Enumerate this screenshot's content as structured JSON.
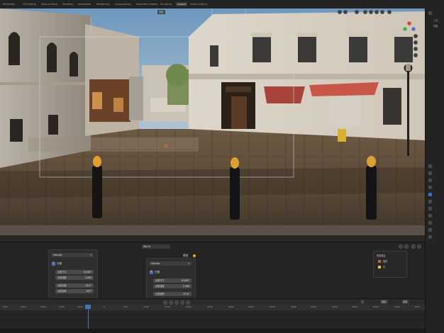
{
  "topbar": {
    "tabs": [
      {
        "label": "Modeling",
        "active": false
      },
      {
        "label": "UV Editing",
        "active": false
      },
      {
        "label": "Texture Paint",
        "active": false
      },
      {
        "label": "Shading",
        "active": false
      },
      {
        "label": "Animation",
        "active": false
      },
      {
        "label": "Rendering",
        "active": false
      },
      {
        "label": "Compositing",
        "active": false
      },
      {
        "label": "Geometry Nodes",
        "active": false
      },
      {
        "label": "Scripting",
        "active": false
      },
      {
        "label": "Layout",
        "active": true
      },
      {
        "label": "Video Editing",
        "active": false
      }
    ]
  },
  "viewport": {
    "view_mode": "视图"
  },
  "right_strip": {
    "labels": [
      "工具",
      "视图"
    ]
  },
  "panel_left": {
    "dropdown": "Nishita",
    "checkbox_label": "日照",
    "fields": [
      {
        "label": "太阳尺寸",
        "value": "0.545°"
      },
      {
        "label": "太阳强度",
        "value": "1.000"
      },
      {
        "label": "太阳高度",
        "value": "14.4°"
      },
      {
        "label": "太阳旋转",
        "value": "107°"
      }
    ]
  },
  "panel_center": {
    "header_icon_label": "World",
    "title": "预览",
    "dropdown": "Nishita",
    "checkbox_label": "日照",
    "fields": [
      {
        "label": "太阳尺寸",
        "value": "0.545°"
      },
      {
        "label": "太阳强度",
        "value": "1.000"
      },
      {
        "label": "太阳旋转",
        "value": "37.4°"
      }
    ]
  },
  "panel_right": {
    "title": "场景集合",
    "items": [
      "相机",
      "灯"
    ]
  },
  "timeline": {
    "current_frame": "1",
    "ticks": [
      "-1000",
      "-2500",
      "-2000",
      "-1500",
      "-1000",
      "-500",
      "0",
      "500",
      "1000",
      "1500",
      "2000",
      "2500",
      "3000",
      "3500",
      "4000",
      "4500",
      "5000",
      "5500",
      "6000",
      "6500",
      "7000",
      "7500",
      "8000"
    ],
    "start_label": "起始",
    "end_label": "结束"
  },
  "colors": {
    "accent": "#4772b3",
    "sky": "#7ea6c8",
    "bollard_cap": "#e0a030"
  }
}
